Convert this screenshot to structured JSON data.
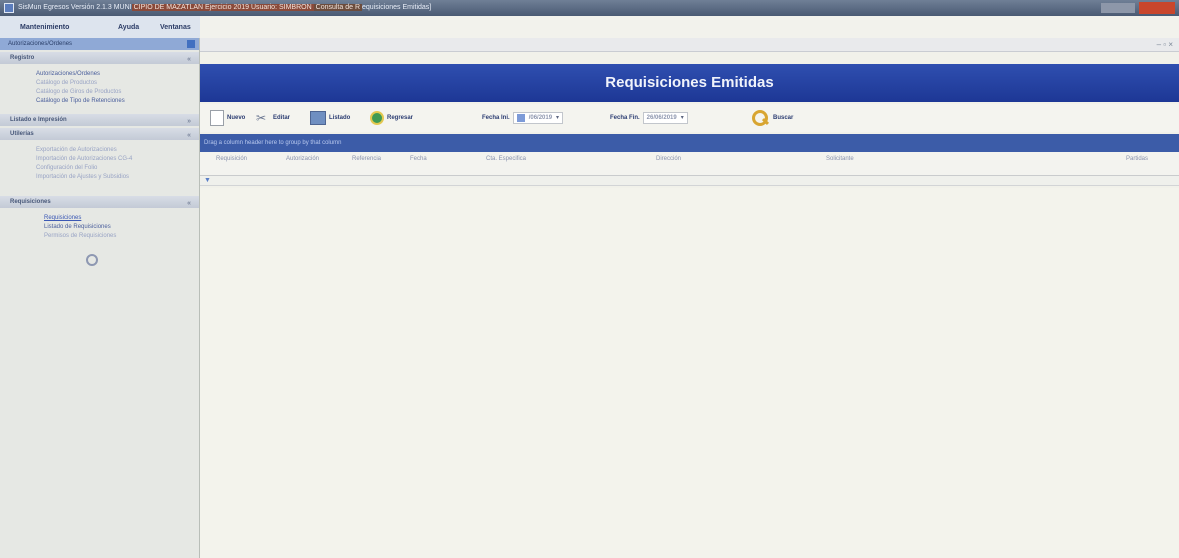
{
  "window": {
    "title_prefix": "SisMun Egresos Versión 2.1.3 MUNI",
    "title_highlight": "CIPIO DE MAZATLAN Ejercicio 2019 Usuario: SIMBRON",
    "title_highlight2": "Consulta de R",
    "title_suffix": "equisiciones Emitidas]"
  },
  "menubar": {
    "items": [
      "Mantenimiento",
      "Ayuda",
      "Ventanas"
    ]
  },
  "sidebar": {
    "header": "Autorizaciones/Ordenes",
    "groups": [
      {
        "title": "Registro",
        "items": [
          "Autorizaciones/Ordenes",
          "Catálogo de Productos",
          "Catálogo de Giros de Productos",
          "Catálogo de Tipo de Retenciones"
        ]
      },
      {
        "title": "Listado e Impresión",
        "items": []
      },
      {
        "title": "Utilerías",
        "items": [
          "Exportación de Autorizaciones",
          "Importación de Autorizaciones CG-4",
          "Configuración del Folio",
          "Importación de Ajustes y Subsidios"
        ]
      },
      {
        "title": "Requisiciones",
        "items": [
          "Requisiciones",
          "Listado de Requisiciones",
          "Permisos de Requisiciones"
        ]
      }
    ]
  },
  "page": {
    "title": "Requisiciones Emitidas"
  },
  "toolbar": {
    "nuevo": "Nuevo",
    "editar": "Editar",
    "listado": "Listado",
    "regresar": "Regresar",
    "fecha_ini_label": "Fecha Ini.",
    "fecha_ini_value": "/06/2019",
    "fecha_fin_label": "Fecha Fin.",
    "fecha_fin_value": "26/06/2019",
    "buscar": "Buscar"
  },
  "grid": {
    "group_hint": "Drag a column header here to group by that column",
    "columns": [
      "Requisición",
      "Autorización",
      "Referencia",
      "Fecha",
      "Cta. Especifica",
      "Dirección",
      "Solicitante",
      "Partidas"
    ]
  },
  "colors": {
    "title_band": "#1d3795",
    "group_panel": "#3c5ca8"
  }
}
